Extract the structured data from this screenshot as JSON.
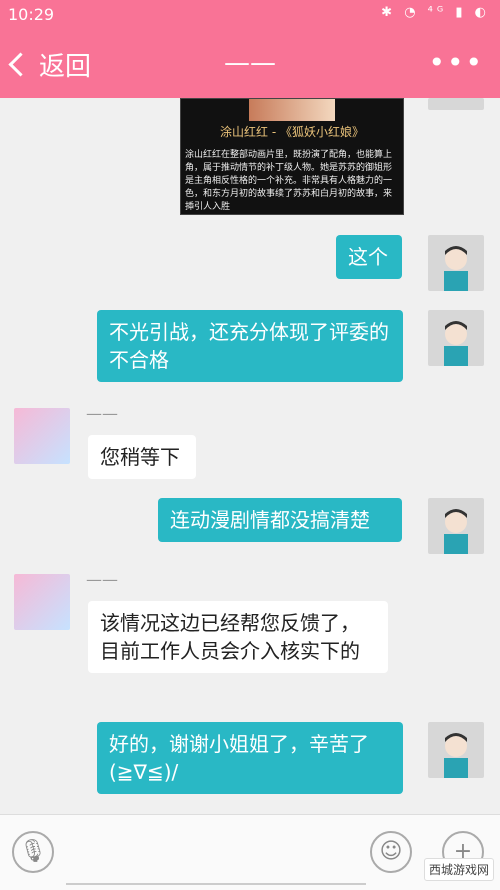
{
  "status": {
    "time": "10:29",
    "icons": "✱ ◔ ⁴ᴳ ▮ ◐"
  },
  "header": {
    "back_label": "返回",
    "title": "——",
    "more_label": "•••"
  },
  "card": {
    "title": "涂山红红 - 《狐妖小红娘》",
    "description": "涂山红红在整部动画片里，既扮演了配角，也能算上角，属于推动情节的补丁级人物。她是苏苏的御姐形是主角相反性格的一个补充。非常具有人格魅力的一色，和东方月初的故事续了苏苏和白月初的故事，来揷引人入胜"
  },
  "messages": [
    {
      "side": "right",
      "text": "这个"
    },
    {
      "side": "right",
      "text": "不光引战，还充分体现了评委的不合格"
    },
    {
      "side": "left",
      "name": "——",
      "text": "您稍等下"
    },
    {
      "side": "right",
      "text": "连动漫剧情都没搞清楚"
    },
    {
      "side": "left",
      "name": "——",
      "text": "该情况这边已经帮您反馈了，目前工作人员会介入核实下的"
    },
    {
      "side": "right",
      "text": "好的，谢谢小姐姐了，辛苦了(≧∇≦)/"
    }
  ],
  "input": {
    "voice_icon": "microphone-icon",
    "emoji_icon": "smiley-icon",
    "plus_icon": "plus-icon"
  },
  "watermark": "西城游戏网"
}
